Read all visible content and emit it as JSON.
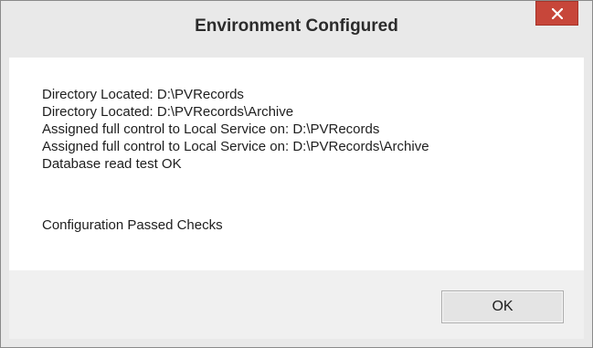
{
  "window": {
    "title": "Environment Configured",
    "close_icon": "close-icon"
  },
  "messages": [
    "Directory Located: D:\\PVRecords",
    "Directory Located: D:\\PVRecords\\Archive",
    "Assigned full control to Local Service on: D:\\PVRecords",
    "Assigned full control to Local Service on: D:\\PVRecords\\Archive",
    "Database read test OK"
  ],
  "status": "Configuration Passed Checks",
  "buttons": {
    "ok_label": "OK"
  },
  "colors": {
    "close_button": "#c7463a",
    "chrome": "#e9e9e9",
    "content_background": "#ffffff",
    "footer_background": "#f0f0f0"
  }
}
